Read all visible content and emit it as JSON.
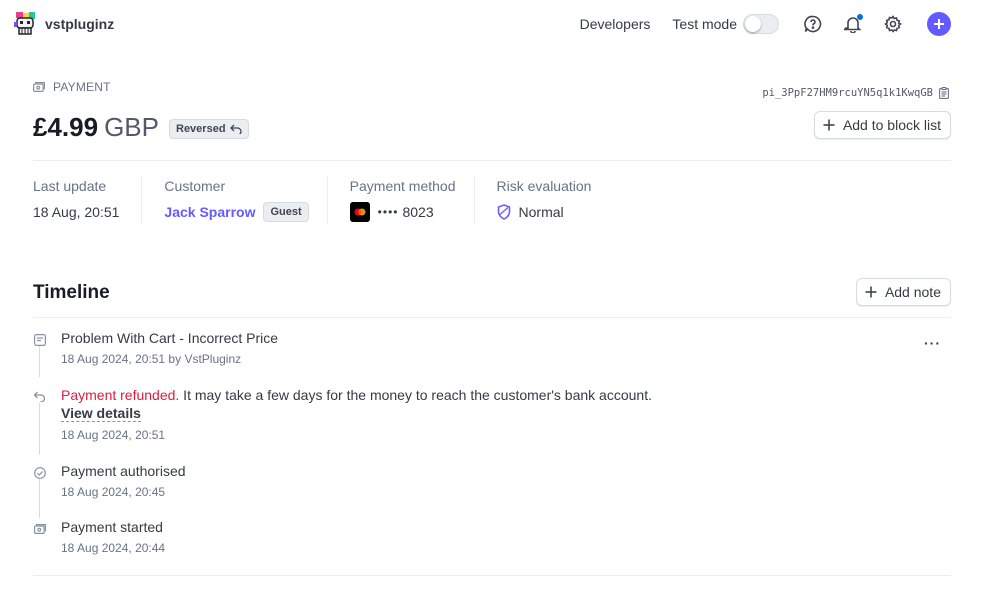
{
  "brand": {
    "name": "vstpluginz"
  },
  "topbar": {
    "developers": "Developers",
    "test_mode": "Test mode",
    "icons": [
      "help-icon",
      "bell-icon",
      "gear-icon",
      "plus-icon"
    ]
  },
  "header": {
    "kicker": "PAYMENT",
    "payment_id": "pi_3PpF27HM9rcuYN5q1k1KwqGB",
    "amount": "£4.99",
    "currency": "GBP",
    "status_badge": "Reversed",
    "block_button": "Add to block list"
  },
  "summary": {
    "last_update_label": "Last update",
    "last_update_value": "18 Aug, 20:51",
    "customer_label": "Customer",
    "customer_name": "Jack Sparrow",
    "customer_badge": "Guest",
    "method_label": "Payment method",
    "method_dots": "••••",
    "method_last4": "8023",
    "risk_label": "Risk evaluation",
    "risk_value": "Normal"
  },
  "timeline": {
    "title": "Timeline",
    "add_note": "Add note",
    "more": "···",
    "items": [
      {
        "icon": "note-icon",
        "text": "Problem With Cart - Incorrect Price",
        "sub": "18 Aug 2024, 20:51 by VstPluginz"
      },
      {
        "icon": "refund-icon",
        "highlight": "Payment refunded.",
        "text": " It may take a few days for the money to reach the customer's bank account.",
        "link": "View details",
        "sub": "18 Aug 2024, 20:51"
      },
      {
        "icon": "check-circle-icon",
        "text": "Payment authorised",
        "sub": "18 Aug 2024, 20:45"
      },
      {
        "icon": "payment-icon",
        "text": "Payment started",
        "sub": "18 Aug 2024, 20:44"
      }
    ]
  },
  "colors": {
    "accent": "#635bff",
    "refund": "#df1b41",
    "notification": "#0570de"
  }
}
